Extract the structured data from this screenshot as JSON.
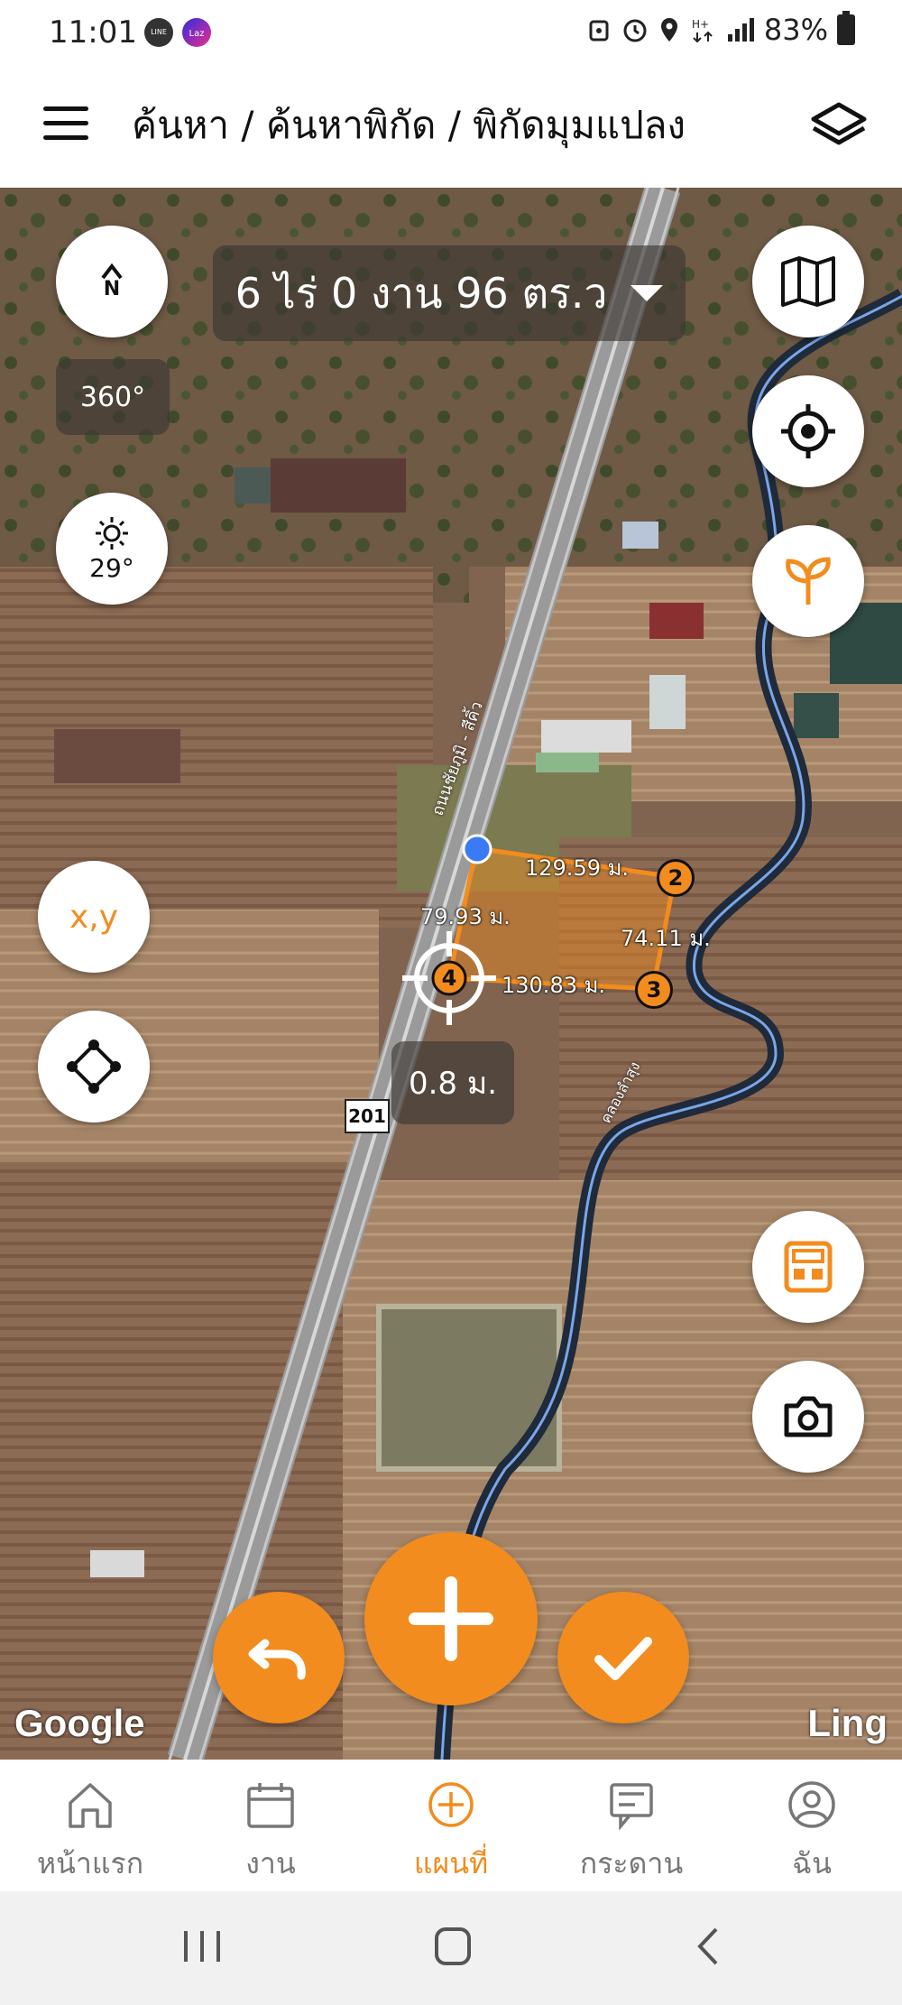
{
  "status_bar": {
    "time": "11:01",
    "app_icons": [
      "line-icon",
      "lazada-icon"
    ],
    "battery": "83%",
    "icons": [
      "alarm-icon",
      "clock-icon",
      "location-icon",
      "data-icon",
      "signal-icon",
      "battery-icon"
    ]
  },
  "header": {
    "breadcrumb": "ค้นหา / ค้นหาพิกัด / พิกัดมุมแปลง"
  },
  "map": {
    "area_label": "6 ไร่ 0 งาน 96 ตร.ว",
    "compass_label": "N",
    "heading": "360°",
    "sun_angle": "29°",
    "xy_label": "x,y",
    "distance": "0.8 ม.",
    "road_name": "ถนนชัยภูมิ - สีคิ้ว",
    "canal_name": "คลองลำสุง",
    "route_number": "201",
    "measurements": {
      "top": "129.59 ม.",
      "left": "79.93 ม.",
      "right": "74.11 ม.",
      "bottom": "130.83 ม."
    },
    "vertices": [
      "2",
      "3",
      "4"
    ],
    "attribution_left": "Google",
    "attribution_right": "Ling",
    "accent_color": "#f28c1e"
  },
  "bottom_nav": {
    "items": [
      {
        "label": "หน้าแรก",
        "icon": "home-icon"
      },
      {
        "label": "งาน",
        "icon": "calendar-icon"
      },
      {
        "label": "แผนที่",
        "icon": "plus-circle-icon",
        "active": true
      },
      {
        "label": "กระดาน",
        "icon": "board-icon"
      },
      {
        "label": "ฉัน",
        "icon": "user-icon"
      }
    ]
  }
}
